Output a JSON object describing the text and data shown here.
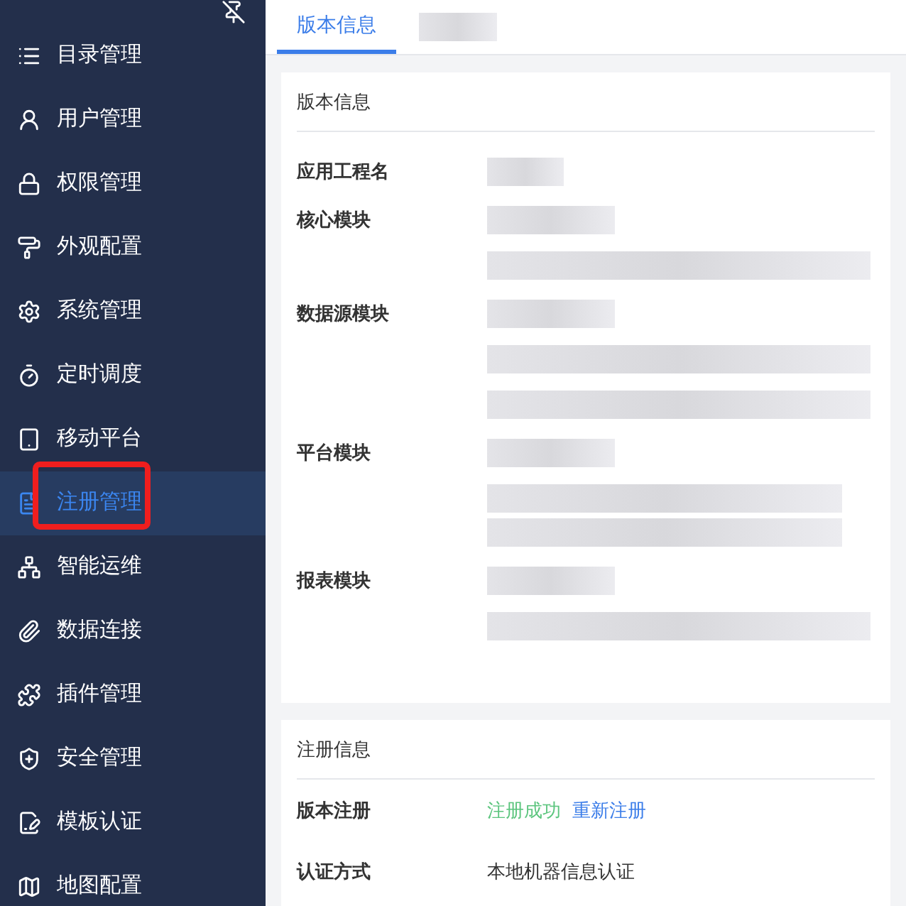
{
  "sidebar": {
    "items": [
      {
        "label": "目录管理",
        "selected": false,
        "highlighted": false
      },
      {
        "label": "用户管理",
        "selected": false,
        "highlighted": false
      },
      {
        "label": "权限管理",
        "selected": false,
        "highlighted": false
      },
      {
        "label": "外观配置",
        "selected": false,
        "highlighted": false
      },
      {
        "label": "系统管理",
        "selected": false,
        "highlighted": false
      },
      {
        "label": "定时调度",
        "selected": false,
        "highlighted": false
      },
      {
        "label": "移动平台",
        "selected": false,
        "highlighted": false
      },
      {
        "label": "注册管理",
        "selected": true,
        "highlighted": true
      },
      {
        "label": "智能运维",
        "selected": false,
        "highlighted": false
      },
      {
        "label": "数据连接",
        "selected": false,
        "highlighted": false
      },
      {
        "label": "插件管理",
        "selected": false,
        "highlighted": false
      },
      {
        "label": "安全管理",
        "selected": false,
        "highlighted": false
      },
      {
        "label": "模板认证",
        "selected": false,
        "highlighted": false
      },
      {
        "label": "地图配置",
        "selected": false,
        "highlighted": false
      }
    ]
  },
  "tabs": [
    {
      "label": "版本信息",
      "selected": true
    }
  ],
  "version_info": {
    "title": "版本信息",
    "rows": [
      {
        "label": "应用工程名"
      },
      {
        "label": "核心模块"
      },
      {
        "label": "数据源模块"
      },
      {
        "label": "平台模块"
      },
      {
        "label": "报表模块"
      }
    ]
  },
  "registration_info": {
    "title": "注册信息",
    "rows": [
      {
        "label": "版本注册",
        "status": "注册成功",
        "link": "重新注册"
      },
      {
        "label": "认证方式",
        "value": "本地机器信息认证"
      }
    ]
  }
}
